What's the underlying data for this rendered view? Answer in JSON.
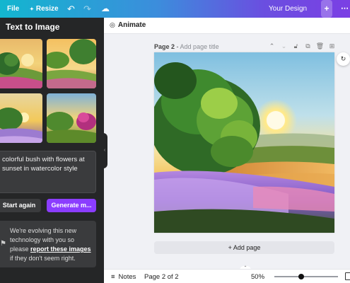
{
  "topbar": {
    "file_label": "File",
    "resize_label": "Resize",
    "undo_icon": "undo-icon",
    "redo_icon": "redo-icon",
    "cloud_icon": "cloud-icon",
    "title": "Your Design",
    "plus_icon": "plus-icon",
    "more_icon": "more-icon"
  },
  "panel": {
    "title": "Text to Image",
    "prompt": "colorful bush with flowers at\nsunset in watercolor style",
    "try_again_label": "Start again",
    "generate_label": "Generate m...",
    "notice_before": "We're evolving this new technology with you so please ",
    "notice_link": "report these images",
    "notice_after": " if they don't seem right.",
    "thumbnails": [
      "image-1",
      "image-2",
      "image-3",
      "image-4"
    ]
  },
  "editor": {
    "animate_label": "Animate",
    "page_label": "Page 2",
    "page_sep": " - ",
    "page_title_placeholder": "Add page title",
    "add_page_label": "+ Add page"
  },
  "bottombar": {
    "notes_label": "Notes",
    "page_info": "Page 2 of 2",
    "zoom": "50%",
    "zoom_slider_fraction": 0.42
  },
  "colors": {
    "accent": "#8b3dff",
    "panel_bg": "#252627"
  }
}
